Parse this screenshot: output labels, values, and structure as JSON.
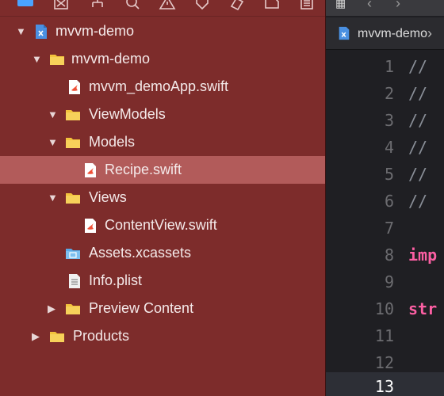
{
  "navigator": {
    "toolbar_icons": [
      "folder-icon",
      "source-control-icon",
      "hierarchy-icon",
      "search-icon",
      "warning-icon",
      "tag-icon",
      "breakpoint-icon",
      "report-icon",
      "list-icon"
    ],
    "items": [
      {
        "label": "mvvm-demo",
        "type": "project",
        "expanded": true
      },
      {
        "label": "mvvm-demo",
        "type": "folder",
        "expanded": true
      },
      {
        "label": "mvvm_demoApp.swift",
        "type": "swift"
      },
      {
        "label": "ViewModels",
        "type": "folder",
        "expanded": true
      },
      {
        "label": "Models",
        "type": "folder",
        "expanded": true
      },
      {
        "label": "Recipe.swift",
        "type": "swift",
        "selected": true
      },
      {
        "label": "Views",
        "type": "folder",
        "expanded": true
      },
      {
        "label": "ContentView.swift",
        "type": "swift"
      },
      {
        "label": "Assets.xcassets",
        "type": "assets"
      },
      {
        "label": "Info.plist",
        "type": "plist"
      },
      {
        "label": "Preview Content",
        "type": "folder",
        "expanded": false
      },
      {
        "label": "Products",
        "type": "folder",
        "expanded": false
      }
    ]
  },
  "editor": {
    "tab_label": "mvvm-demo",
    "lines": [
      {
        "n": "1",
        "code": "//"
      },
      {
        "n": "2",
        "code": "//"
      },
      {
        "n": "3",
        "code": "//"
      },
      {
        "n": "4",
        "code": "//"
      },
      {
        "n": "5",
        "code": "//"
      },
      {
        "n": "6",
        "code": "//"
      },
      {
        "n": "7",
        "code": ""
      },
      {
        "n": "8",
        "code": "imp"
      },
      {
        "n": "9",
        "code": ""
      },
      {
        "n": "10",
        "code": "str"
      },
      {
        "n": "11",
        "code": ""
      },
      {
        "n": "12",
        "code": ""
      },
      {
        "n": "13",
        "code": ""
      }
    ]
  },
  "colors": {
    "navigator_bg": "#7d2c2b",
    "selection": "#b25b5a",
    "folder": "#f3c23c",
    "swift": "#f05138",
    "keyword": "#fc5fa3",
    "editor_bg": "#1f1f23"
  }
}
